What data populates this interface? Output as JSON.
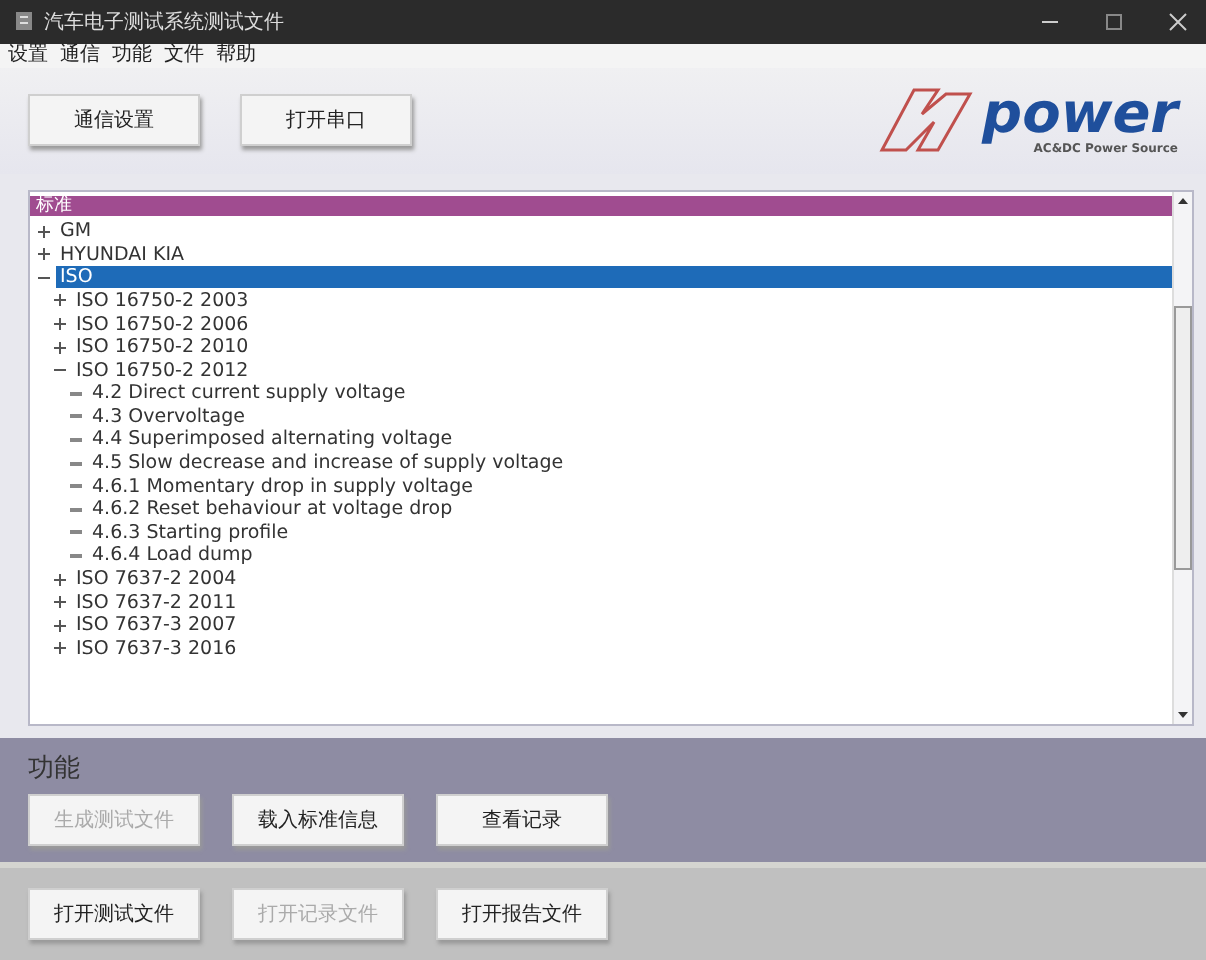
{
  "window": {
    "title": "汽车电子测试系统测试文件"
  },
  "menu": [
    "设置",
    "通信",
    "功能",
    "文件",
    "帮助"
  ],
  "toolbar": [
    {
      "label": "通信设置"
    },
    {
      "label": "打开串口"
    }
  ],
  "logo": {
    "text": "power",
    "subtitle": "AC&DC Power Source"
  },
  "tree": {
    "header": "标准",
    "items": [
      {
        "label": "GM",
        "expanded": false,
        "selected": false
      },
      {
        "label": "HYUNDAI KIA",
        "expanded": false,
        "selected": false
      },
      {
        "label": "ISO",
        "expanded": true,
        "selected": true,
        "children": [
          {
            "label": "ISO 16750-2 2003",
            "expanded": false,
            "selected": false
          },
          {
            "label": "ISO 16750-2 2006",
            "expanded": false,
            "selected": false
          },
          {
            "label": "ISO 16750-2 2010",
            "expanded": false,
            "selected": false
          },
          {
            "label": "ISO 16750-2 2012",
            "expanded": true,
            "selected": false,
            "children": [
              {
                "label": "4.2 Direct current supply voltage",
                "selected": false
              },
              {
                "label": "4.3 Overvoltage",
                "selected": false
              },
              {
                "label": "4.4 Superimposed alternating voltage",
                "selected": false
              },
              {
                "label": "4.5 Slow decrease and increase of supply voltage",
                "selected": false
              },
              {
                "label": "4.6.1 Momentary drop in supply voltage",
                "selected": false
              },
              {
                "label": "4.6.2 Reset behaviour at voltage drop",
                "selected": false
              },
              {
                "label": "4.6.3 Starting profile",
                "selected": false
              },
              {
                "label": "4.6.4 Load dump",
                "selected": false
              }
            ]
          },
          {
            "label": "ISO 7637-2 2004",
            "expanded": false,
            "selected": false
          },
          {
            "label": "ISO 7637-2 2011",
            "expanded": false,
            "selected": false
          },
          {
            "label": "ISO 7637-3 2007",
            "expanded": false,
            "selected": false
          },
          {
            "label": "ISO 7637-3 2016",
            "expanded": false,
            "selected": false
          }
        ]
      }
    ]
  },
  "functions": {
    "title": "功能",
    "buttons": [
      {
        "label": "生成测试文件",
        "disabled": true
      },
      {
        "label": "载入标准信息",
        "disabled": false
      },
      {
        "label": "查看记录",
        "disabled": false
      }
    ]
  },
  "files": {
    "buttons": [
      {
        "label": "打开测试文件",
        "disabled": false
      },
      {
        "label": "打开记录文件",
        "disabled": true
      },
      {
        "label": "打开报告文件",
        "disabled": false
      }
    ]
  }
}
